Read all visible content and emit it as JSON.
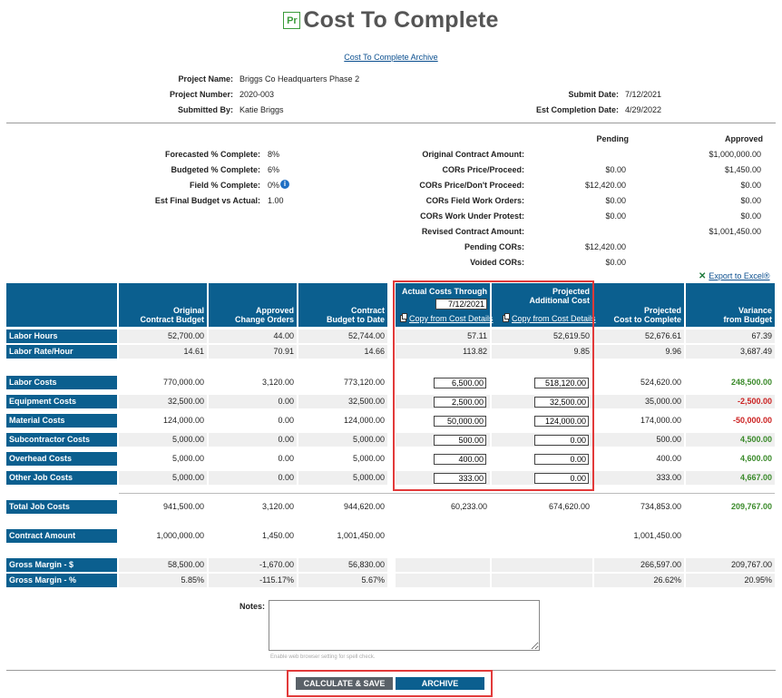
{
  "header": {
    "logo_text": "Pr",
    "title": "Cost To Complete",
    "archive_link": "Cost To Complete Archive"
  },
  "project": {
    "name_label": "Project Name:",
    "name": "Briggs Co Headquarters Phase 2",
    "number_label": "Project Number:",
    "number": "2020-003",
    "submitted_by_label": "Submitted By:",
    "submitted_by": "Katie Briggs",
    "submit_date_label": "Submit Date:",
    "submit_date": "7/12/2021",
    "completion_label": "Est Completion Date:",
    "completion": "4/29/2022"
  },
  "stats": [
    {
      "label": "Forecasted % Complete:",
      "value": "8%"
    },
    {
      "label": "Budgeted % Complete:",
      "value": "6%"
    },
    {
      "label": "Field % Complete:",
      "value": "0%"
    },
    {
      "label": "Est Final Budget vs Actual:",
      "value": "1.00"
    }
  ],
  "contract": {
    "pending_header": "Pending",
    "approved_header": "Approved",
    "rows": [
      {
        "label": "Original Contract Amount:",
        "pending": "",
        "approved": "$1,000,000.00"
      },
      {
        "label": "CORs Price/Proceed:",
        "pending": "$0.00",
        "approved": "$1,450.00"
      },
      {
        "label": "CORs Price/Don't Proceed:",
        "pending": "$12,420.00",
        "approved": "$0.00"
      },
      {
        "label": "CORs Field Work Orders:",
        "pending": "$0.00",
        "approved": "$0.00"
      },
      {
        "label": "CORs Work Under Protest:",
        "pending": "$0.00",
        "approved": "$0.00"
      },
      {
        "label": "Revised Contract Amount:",
        "pending": "",
        "approved": "$1,001,450.00"
      },
      {
        "label": "Pending CORs:",
        "pending": "$12,420.00",
        "approved": ""
      },
      {
        "label": "Voided CORs:",
        "pending": "$0.00",
        "approved": ""
      }
    ]
  },
  "export_label": "Export to Excel®",
  "columns": {
    "c1": [
      "Original",
      "Contract Budget"
    ],
    "c2": [
      "Approved",
      "Change Orders"
    ],
    "c3": [
      "Contract",
      "Budget to Date"
    ],
    "c4_title": "Actual Costs Through",
    "c4_date": "7/12/2021",
    "c5": [
      "Projected",
      "Additional Cost"
    ],
    "c6": [
      "Projected",
      "Cost to Complete"
    ],
    "c7": [
      "Variance",
      "from Budget"
    ],
    "copy_link": "Copy from Cost Details"
  },
  "labor": [
    {
      "label": "Labor Hours",
      "c1": "52,700.00",
      "c2": "44.00",
      "c3": "52,744.00",
      "c4": "57.11",
      "c5": "52,619.50",
      "c6": "52,676.61",
      "c7": "67.39"
    },
    {
      "label": "Labor Rate/Hour",
      "c1": "14.61",
      "c2": "70.91",
      "c3": "14.66",
      "c4": "113.82",
      "c5": "9.85",
      "c6": "9.96",
      "c7": "3,687.49"
    }
  ],
  "costs": [
    {
      "label": "Labor Costs",
      "c1": "770,000.00",
      "c2": "3,120.00",
      "c3": "773,120.00",
      "c4": "6,500.00",
      "c5": "518,120.00",
      "c6": "524,620.00",
      "c7": "248,500.00",
      "sign": "pos"
    },
    {
      "label": "Equipment Costs",
      "c1": "32,500.00",
      "c2": "0.00",
      "c3": "32,500.00",
      "c4": "2,500.00",
      "c5": "32,500.00",
      "c6": "35,000.00",
      "c7": "-2,500.00",
      "sign": "neg"
    },
    {
      "label": "Material Costs",
      "c1": "124,000.00",
      "c2": "0.00",
      "c3": "124,000.00",
      "c4": "50,000.00",
      "c5": "124,000.00",
      "c6": "174,000.00",
      "c7": "-50,000.00",
      "sign": "neg"
    },
    {
      "label": "Subcontractor Costs",
      "c1": "5,000.00",
      "c2": "0.00",
      "c3": "5,000.00",
      "c4": "500.00",
      "c5": "0.00",
      "c6": "500.00",
      "c7": "4,500.00",
      "sign": "pos"
    },
    {
      "label": "Overhead Costs",
      "c1": "5,000.00",
      "c2": "0.00",
      "c3": "5,000.00",
      "c4": "400.00",
      "c5": "0.00",
      "c6": "400.00",
      "c7": "4,600.00",
      "sign": "pos"
    },
    {
      "label": "Other Job Costs",
      "c1": "5,000.00",
      "c2": "0.00",
      "c3": "5,000.00",
      "c4": "333.00",
      "c5": "0.00",
      "c6": "333.00",
      "c7": "4,667.00",
      "sign": "pos"
    }
  ],
  "totals": {
    "label": "Total Job Costs",
    "c1": "941,500.00",
    "c2": "3,120.00",
    "c3": "944,620.00",
    "c4": "60,233.00",
    "c5": "674,620.00",
    "c6": "734,853.00",
    "c7": "209,767.00"
  },
  "contract_amount": {
    "label": "Contract Amount",
    "c1": "1,000,000.00",
    "c2": "1,450.00",
    "c3": "1,001,450.00",
    "c6": "1,001,450.00"
  },
  "margins": [
    {
      "label": "Gross Margin - $",
      "c1": "58,500.00",
      "c2": "-1,670.00",
      "c3": "56,830.00",
      "c6": "266,597.00",
      "c7": "209,767.00"
    },
    {
      "label": "Gross Margin - %",
      "c1": "5.85%",
      "c2": "-115.17%",
      "c3": "5.67%",
      "c6": "26.62%",
      "c7": "20.95%"
    }
  ],
  "notes": {
    "label": "Notes:",
    "hint": "Enable web browser setting for spell check."
  },
  "buttons": {
    "calculate": "CALCULATE & SAVE",
    "archive": "ARCHIVE"
  },
  "colors": {
    "header_blue": "#0b5f8f",
    "highlight_red": "#e23a3a",
    "positive": "#3a8a2a",
    "negative": "#cc2222"
  }
}
